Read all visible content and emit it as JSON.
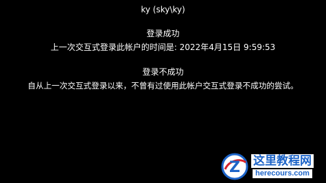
{
  "account": {
    "display": "ky (sky\\ky)"
  },
  "success": {
    "title": "登录成功",
    "message": "上一次交互式登录此帐户的时间是: 2022年4月15日 9:59:53"
  },
  "failure": {
    "title": "登录不成功",
    "message": "自从上一次交互式登录以来，不曾有过使用此帐户交互式登录不成功的尝试。"
  },
  "watermark": {
    "brand": "这里教程网",
    "url": "herecours.com",
    "colors": {
      "brand": "#1d64c8",
      "accent": "#d8232a"
    }
  }
}
